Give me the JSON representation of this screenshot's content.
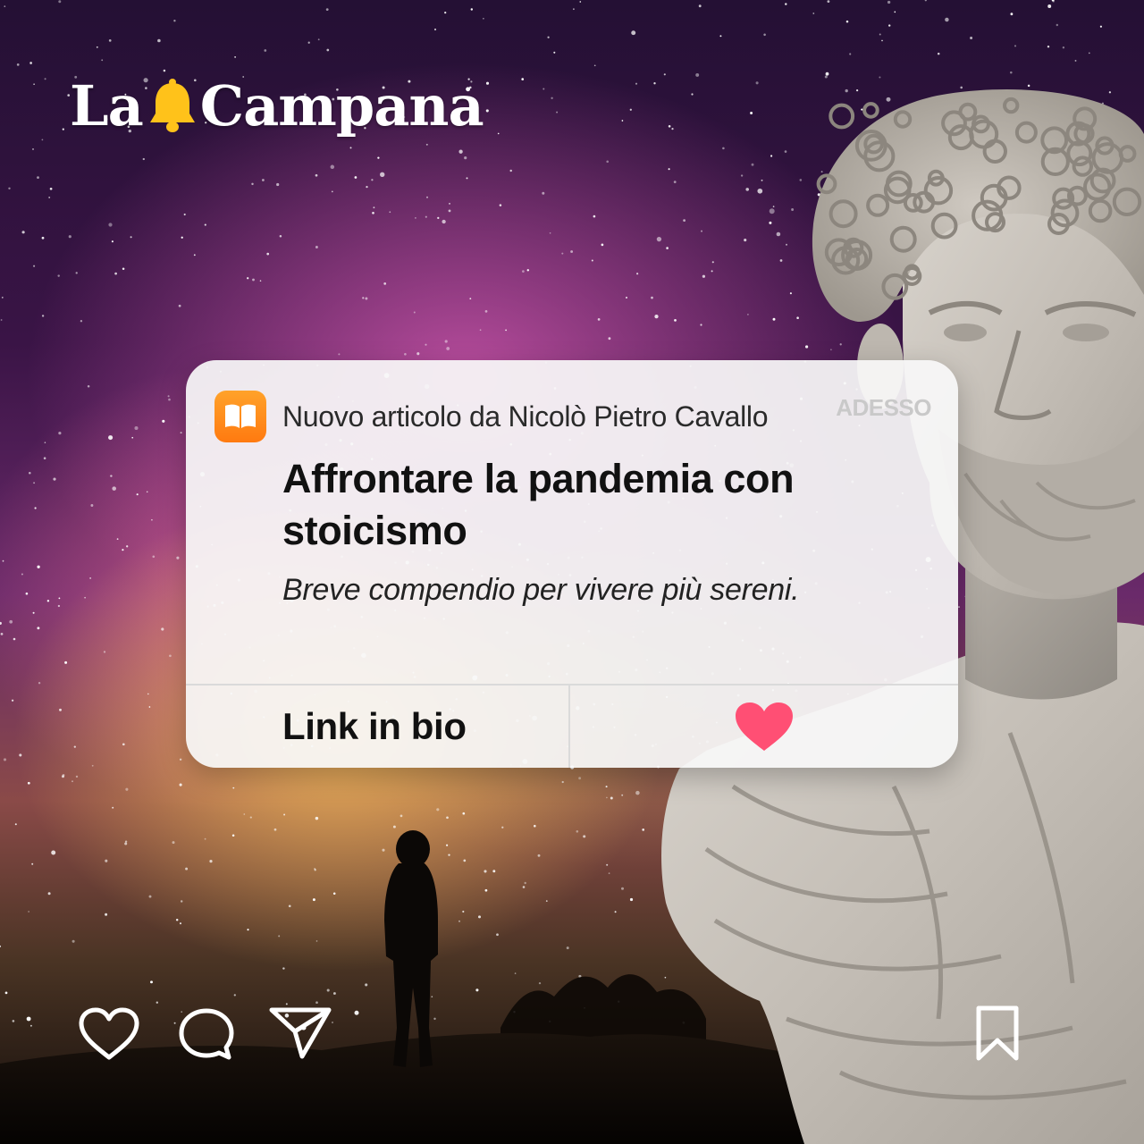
{
  "brand": {
    "name_part1": "La",
    "name_part2": "Campana",
    "bell_icon": "bell-icon"
  },
  "notification": {
    "app_icon": "book-icon",
    "source": "Nuovo articolo da Nicolò Pietro Cavallo",
    "time": "ADESSO",
    "title": "Affrontare la pandemia con stoicismo",
    "subtitle": "Breve compendio per vivere più sereni.",
    "action_label": "Link in bio",
    "reaction_icon": "heart-icon"
  },
  "post_actions": {
    "like_icon": "heart-outline-icon",
    "comment_icon": "comment-icon",
    "share_icon": "paper-plane-icon",
    "save_icon": "bookmark-icon"
  },
  "colors": {
    "brand_yellow": "#ffc21a",
    "app_orange": "#ff8a18",
    "heart_pink": "#ff4f74",
    "card_bg": "#f7f7f7"
  }
}
